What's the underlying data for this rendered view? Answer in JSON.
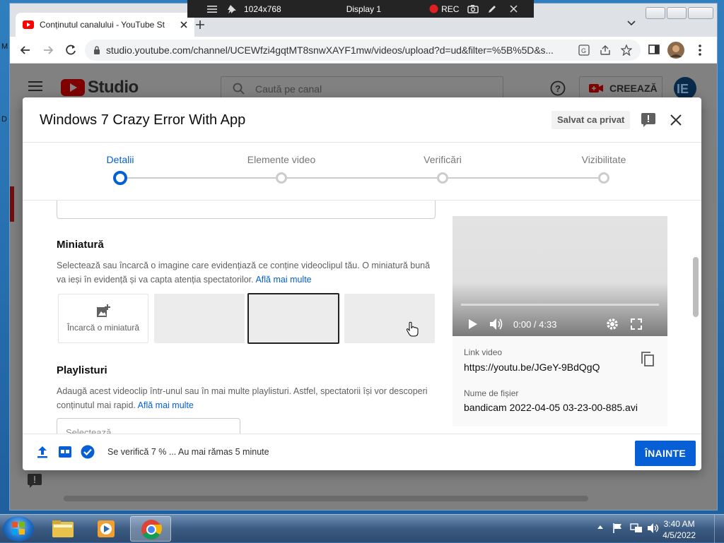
{
  "recorder": {
    "resolution": "1024x768",
    "display": "Display 1",
    "rec_label": "REC"
  },
  "browser": {
    "tab_title": "Conținutul canalului - YouTube St",
    "url": "studio.youtube.com/channel/UCEWfzi4gqtMT8snwXAYF1mw/videos/upload?d=ud&filter=%5B%5D&s..."
  },
  "studio": {
    "logo_text": "Studio",
    "search_placeholder": "Caută pe canal",
    "create_label": "CREEAZĂ"
  },
  "dialog": {
    "title": "Windows 7 Crazy Error With App",
    "saved_chip": "Salvat ca privat",
    "steps": [
      "Detalii",
      "Elemente video",
      "Verificări",
      "Vizibilitate"
    ],
    "active_step": 0,
    "thumbnail": {
      "title": "Miniatură",
      "desc": "Selectează sau încarcă o imagine care evidențiază ce conține videoclipul tău. O miniatură bună va ieși în evidență și va capta atenția spectatorilor.",
      "learn_more": "Află mai multe",
      "upload_label": "Încarcă o miniatură"
    },
    "playlists": {
      "title": "Playlisturi",
      "desc": "Adaugă acest videoclip într-unul sau în mai multe playlisturi. Astfel, spectatorii își vor descoperi conținutul mai rapid.",
      "learn_more": "Află mai multe",
      "select_placeholder": "Selectează"
    },
    "video": {
      "time": "0:00 / 4:33",
      "link_label": "Link video",
      "link": "https://youtu.be/JGeY-9BdQgQ",
      "filename_label": "Nume de fișier",
      "filename": "bandicam 2022-04-05 03-23-00-885.avi"
    },
    "footer": {
      "status": "Se verifică 7 % ... Au mai rămas 5 minute",
      "next_label": "ÎNAINTE"
    }
  },
  "taskbar": {
    "time": "3:40 AM",
    "date": "4/5/2022"
  },
  "colors": {
    "accent": "#065fd4",
    "youtube_red": "#ff0000",
    "overlay": "#7f7f7f"
  }
}
